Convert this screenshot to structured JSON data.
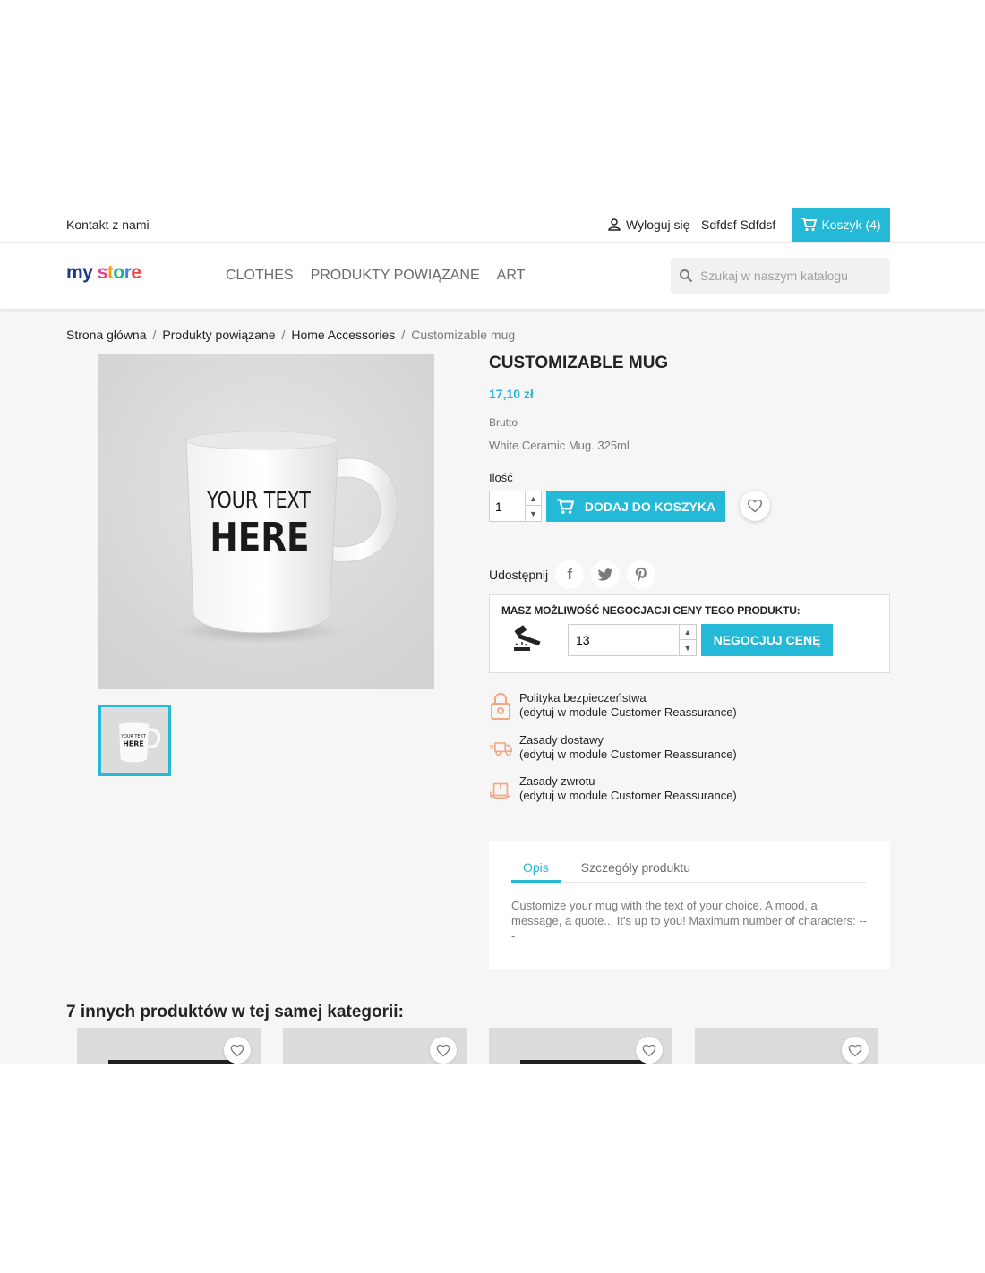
{
  "topbar": {
    "contact": "Kontakt z nami",
    "logout": "Wyloguj się",
    "username": "Sdfdsf Sdfdsf",
    "cart": "Koszyk (4)"
  },
  "header": {
    "logo_my": "my",
    "logo_store": [
      "s",
      "t",
      "o",
      "r",
      "e"
    ],
    "nav": [
      "CLOTHES",
      "PRODUKTY POWIĄZANE",
      "ART"
    ],
    "search_placeholder": "Szukaj w naszym katalogu"
  },
  "breadcrumb": [
    "Strona główna",
    "Produkty powiązane",
    "Home Accessories",
    "Customizable mug"
  ],
  "product": {
    "title": "CUSTOMIZABLE MUG",
    "price": "17,10 zł",
    "tax": "Brutto",
    "short_desc": "White Ceramic Mug. 325ml",
    "mug_text_1": "YOUR TEXT",
    "mug_text_2": "HERE",
    "qty_label": "Ilość",
    "qty_value": "1",
    "add_to_cart": "DODAJ DO KOSZYKA",
    "share_label": "Udostępnij"
  },
  "negotiation": {
    "title": "MASZ MOŻLIWOŚĆ NEGOCJACJI CENY TEGO PRODUKTU:",
    "value": "13",
    "button": "NEGOCJUJ CENĘ"
  },
  "reassurance": [
    {
      "title": "Polityka bezpieczeństwa",
      "note": "(edytuj w module Customer Reassurance)",
      "icon": "lock-icon"
    },
    {
      "title": "Zasady dostawy",
      "note": "(edytuj w module Customer Reassurance)",
      "icon": "truck-icon"
    },
    {
      "title": "Zasady zwrotu",
      "note": "(edytuj w module Customer Reassurance)",
      "icon": "return-box-icon"
    }
  ],
  "tabs": {
    "items": [
      "Opis",
      "Szczegóły produktu"
    ],
    "active": "Opis",
    "content": "Customize your mug with the text of your choice. A mood, a message, a quote... It's up to you! Maximum number of characters: ---"
  },
  "related": {
    "title": "7 innych produktów w tej samej kategorii:"
  },
  "colors": {
    "accent": "#24b9d7",
    "text": "#232323",
    "muted": "#7a7a7a",
    "background": "#f6f6f6"
  }
}
